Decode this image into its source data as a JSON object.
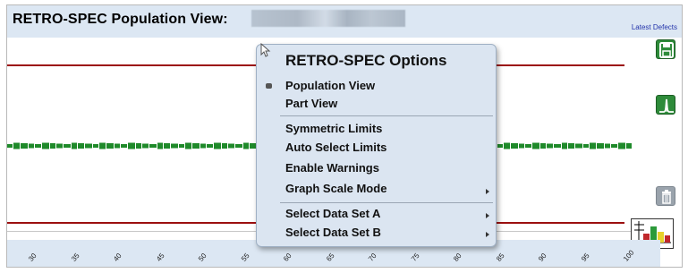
{
  "header": {
    "title": "RETRO-SPEC Population View:",
    "latest_defects_link": "Latest Defects"
  },
  "right_panel": {
    "icons": [
      "save-icon",
      "limits-peak-icon",
      "trash-icon",
      "histogram-chart-icon"
    ],
    "colors": {
      "button_green": "#2e8b3a",
      "trash_gray": "#9aa3ac"
    }
  },
  "menu": {
    "title": "RETRO-SPEC Options",
    "items": [
      {
        "label": "Population View",
        "selected": true,
        "submenu": false
      },
      {
        "label": "Part View",
        "selected": false,
        "submenu": false
      },
      {
        "label": "Symmetric Limits",
        "selected": false,
        "submenu": false
      },
      {
        "label": "Auto Select Limits",
        "selected": false,
        "submenu": false,
        "highlighted": true
      },
      {
        "label": "Enable Warnings",
        "selected": false,
        "submenu": false
      },
      {
        "label": "Graph Scale Mode",
        "selected": false,
        "submenu": true
      },
      {
        "label": "Select Data Set A",
        "selected": false,
        "submenu": true
      },
      {
        "label": "Select Data Set B",
        "selected": false,
        "submenu": true
      }
    ]
  },
  "x_axis": {
    "ticks": [
      "30",
      "35",
      "40",
      "45",
      "50",
      "55",
      "60",
      "65",
      "70",
      "75",
      "80",
      "85",
      "90",
      "95",
      "100"
    ]
  },
  "colors": {
    "header_bg": "#dce7f3",
    "limit_line": "#9c1010",
    "data_green": "#1f8a2a",
    "bar_red": "#b01c1c",
    "menu_bg": "#dbe5f1",
    "highlight_box": "#e85b5b"
  },
  "chart_data": {
    "type": "bar",
    "note_labels": [],
    "categories": [],
    "values": []
  }
}
